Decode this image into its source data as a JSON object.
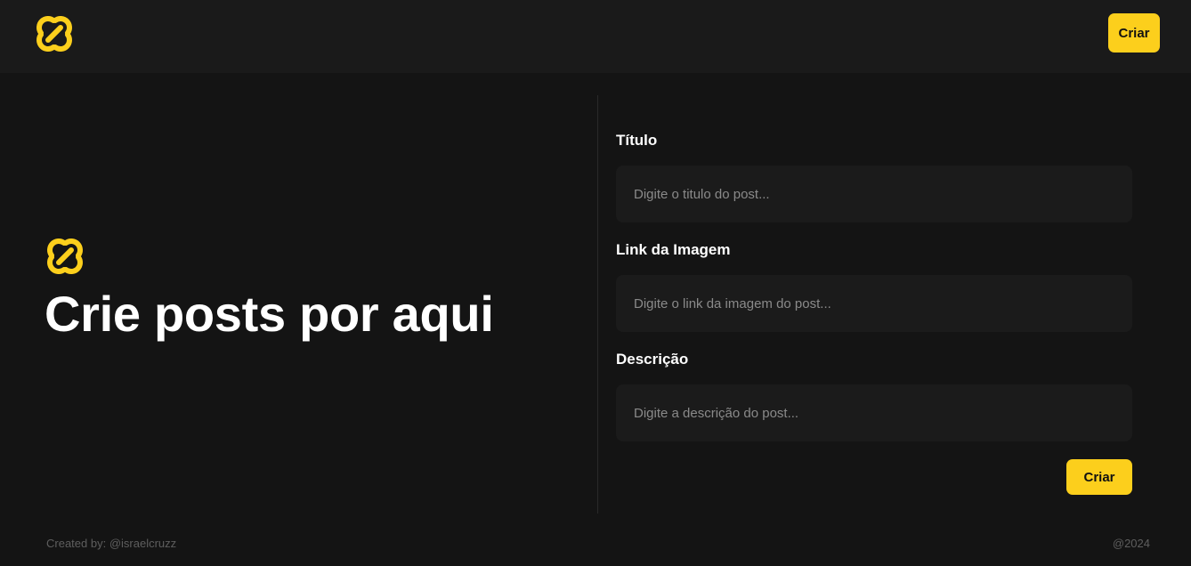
{
  "header": {
    "logo_icon": "interlocking-links-logo-icon",
    "create_button_label": "Criar"
  },
  "hero": {
    "logo_icon": "interlocking-links-logo-icon",
    "title": "Crie posts por aqui"
  },
  "form": {
    "title_label": "Título",
    "title_placeholder": "Digite o titulo do post...",
    "image_label": "Link da Imagem",
    "image_placeholder": "Digite o link da imagem do post...",
    "description_label": "Descrição",
    "description_placeholder": "Digite a descrição do post...",
    "submit_label": "Criar"
  },
  "footer": {
    "credit": "Created by: @israelcruzz",
    "year": "@2024"
  },
  "colors": {
    "accent": "#fccf1c",
    "background": "#141414",
    "header_background": "#1a1a1a",
    "input_background": "#1b1b1b"
  }
}
